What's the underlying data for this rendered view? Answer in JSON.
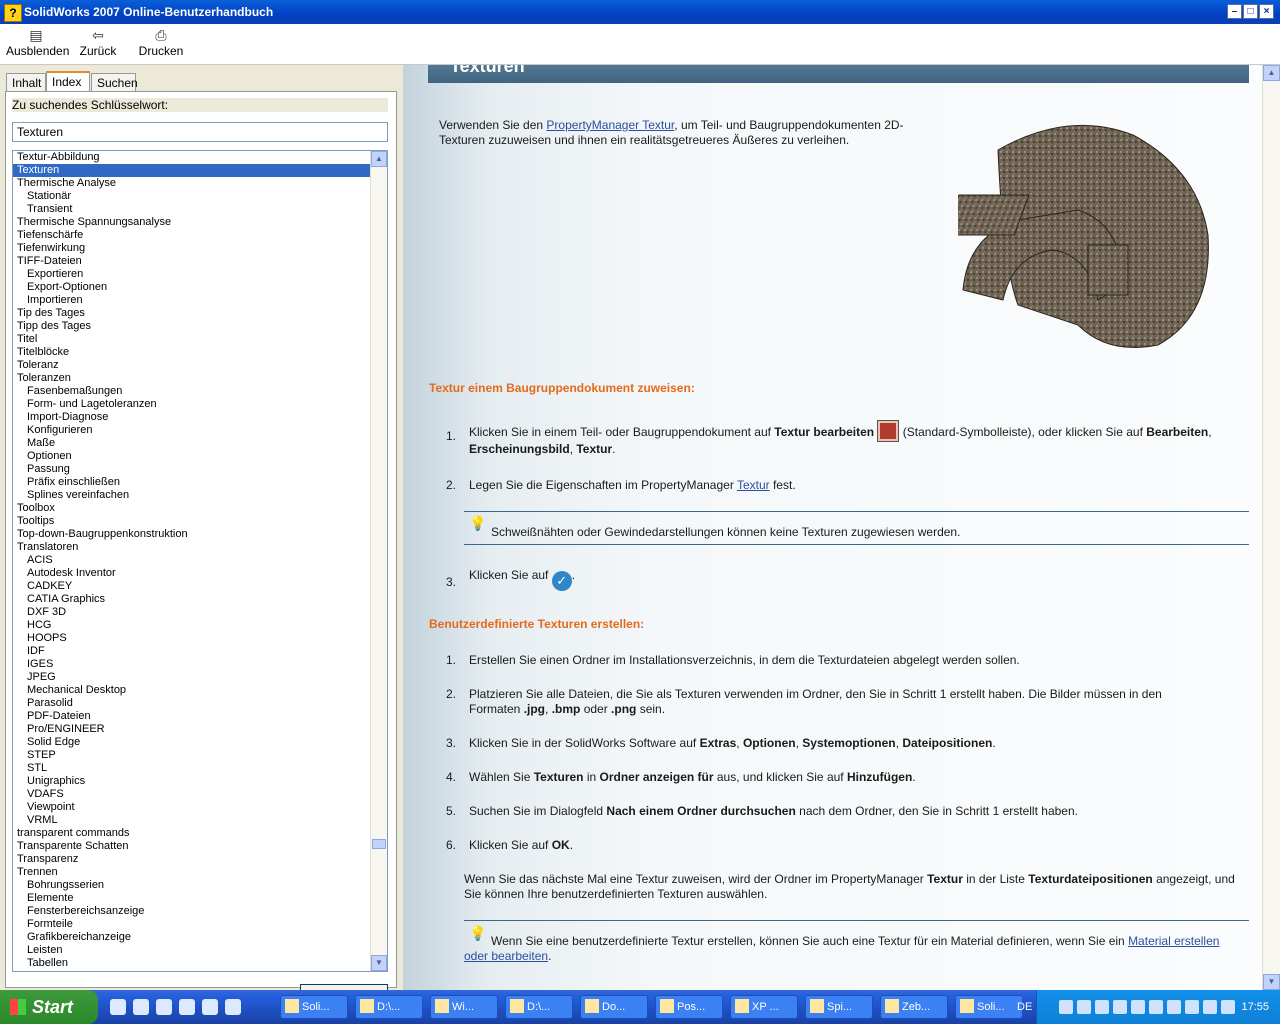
{
  "window": {
    "title": "SolidWorks 2007 Online-Benutzerhandbuch",
    "app_icon": "help-book-icon"
  },
  "toolbar": {
    "hide_label": "Ausblenden",
    "back_label": "Zurück",
    "print_label": "Drucken"
  },
  "tabs": [
    "Inhalt",
    "Index",
    "Suchen"
  ],
  "search": {
    "label": "Zu suchendes Schlüsselwort:",
    "value": "Texturen"
  },
  "index_items": [
    {
      "t": "Textur-Abbildung",
      "l": 0
    },
    {
      "t": "Texturen",
      "l": 0,
      "sel": true
    },
    {
      "t": "Thermische Analyse",
      "l": 0
    },
    {
      "t": "Stationär",
      "l": 1
    },
    {
      "t": "Transient",
      "l": 1
    },
    {
      "t": "Thermische Spannungsanalyse",
      "l": 0
    },
    {
      "t": "Tiefenschärfe",
      "l": 0
    },
    {
      "t": "Tiefenwirkung",
      "l": 0
    },
    {
      "t": "TIFF-Dateien",
      "l": 0
    },
    {
      "t": "Exportieren",
      "l": 1
    },
    {
      "t": "Export-Optionen",
      "l": 1
    },
    {
      "t": "Importieren",
      "l": 1
    },
    {
      "t": "Tip des Tages",
      "l": 0
    },
    {
      "t": "Tipp des Tages",
      "l": 0
    },
    {
      "t": "Titel",
      "l": 0
    },
    {
      "t": "Titelblöcke",
      "l": 0
    },
    {
      "t": "Toleranz",
      "l": 0
    },
    {
      "t": "Toleranzen",
      "l": 0
    },
    {
      "t": "Fasenbemaßungen",
      "l": 1
    },
    {
      "t": "Form- und Lagetoleranzen",
      "l": 1
    },
    {
      "t": "Import-Diagnose",
      "l": 1
    },
    {
      "t": "Konfigurieren",
      "l": 1
    },
    {
      "t": "Maße",
      "l": 1
    },
    {
      "t": "Optionen",
      "l": 1
    },
    {
      "t": "Passung",
      "l": 1
    },
    {
      "t": "Präfix einschließen",
      "l": 1
    },
    {
      "t": "Splines vereinfachen",
      "l": 1
    },
    {
      "t": "Toolbox",
      "l": 0
    },
    {
      "t": "Tooltips",
      "l": 0
    },
    {
      "t": "Top-down-Baugruppenkonstruktion",
      "l": 0
    },
    {
      "t": "Translatoren",
      "l": 0
    },
    {
      "t": "ACIS",
      "l": 1
    },
    {
      "t": "Autodesk Inventor",
      "l": 1
    },
    {
      "t": "CADKEY",
      "l": 1
    },
    {
      "t": "CATIA Graphics",
      "l": 1
    },
    {
      "t": "DXF 3D",
      "l": 1
    },
    {
      "t": "HCG",
      "l": 1
    },
    {
      "t": "HOOPS",
      "l": 1
    },
    {
      "t": "IDF",
      "l": 1
    },
    {
      "t": "IGES",
      "l": 1
    },
    {
      "t": "JPEG",
      "l": 1
    },
    {
      "t": "Mechanical Desktop",
      "l": 1
    },
    {
      "t": "Parasolid",
      "l": 1
    },
    {
      "t": "PDF-Dateien",
      "l": 1
    },
    {
      "t": "Pro/ENGINEER",
      "l": 1
    },
    {
      "t": "Solid Edge",
      "l": 1
    },
    {
      "t": "STEP",
      "l": 1
    },
    {
      "t": "STL",
      "l": 1
    },
    {
      "t": "Unigraphics",
      "l": 1
    },
    {
      "t": "VDAFS",
      "l": 1
    },
    {
      "t": "Viewpoint",
      "l": 1
    },
    {
      "t": "VRML",
      "l": 1
    },
    {
      "t": "transparent commands",
      "l": 0
    },
    {
      "t": "Transparente Schatten",
      "l": 0
    },
    {
      "t": "Transparenz",
      "l": 0
    },
    {
      "t": "Trennen",
      "l": 0
    },
    {
      "t": "Bohrungsserien",
      "l": 1
    },
    {
      "t": "Elemente",
      "l": 1
    },
    {
      "t": "Fensterbereichsanzeige",
      "l": 1
    },
    {
      "t": "Formteile",
      "l": 1
    },
    {
      "t": "Grafikbereichanzeige",
      "l": 1
    },
    {
      "t": "Leisten",
      "l": 1
    },
    {
      "t": "Tabellen",
      "l": 1
    }
  ],
  "content": {
    "heading": "Texturen",
    "intro_pre": "Verwenden Sie den ",
    "intro_link": "PropertyManager Textur",
    "intro_post1": ", um Teil- und Baugruppendokumenten 2D-",
    "intro_post2": "Texturen zuzuweisen und ihnen ein realitätsgetreueres Äußeres zu verleihen.",
    "section1_title": "Textur einem Baugruppendokument zuweisen:",
    "s1_1_a": "Klicken Sie in einem Teil- oder Baugruppendokument auf ",
    "s1_1_b": "Textur bearbeiten",
    "s1_1_c": " (Standard-Symbolleiste), oder klicken Sie auf ",
    "s1_1_d": "Bearbeiten",
    "s1_1_e": ",",
    "s1_1_f": "Erscheinungsbild",
    "s1_1_g": ", ",
    "s1_1_h": "Textur",
    "s1_1_i": ".",
    "s1_2_a": "Legen Sie die Eigenschaften im PropertyManager ",
    "s1_2_link": "Textur",
    "s1_2_b": " fest.",
    "note1": "Schweißnähten oder Gewindedarstellungen können keine Texturen zugewiesen werden.",
    "s1_3_a": "Klicken Sie auf ",
    "s1_3_b": ".",
    "section2_title": "Benutzerdefinierte Texturen erstellen:",
    "s2_1": "Erstellen Sie einen Ordner im Installationsverzeichnis, in dem die Texturdateien abgelegt werden sollen.",
    "s2_2_a": "Platzieren Sie alle Dateien, die Sie als Texturen verwenden im Ordner, den Sie in Schritt 1 erstellt haben. Die Bilder müssen in den",
    "s2_2_b": "Formaten ",
    "s2_2_jpg": ".jpg",
    "s2_2_c": ", ",
    "s2_2_bmp": ".bmp",
    "s2_2_d": " oder ",
    "s2_2_png": ".png",
    "s2_2_e": " sein.",
    "s2_3_a": "Klicken Sie in der SolidWorks Software auf ",
    "s2_3_b": "Extras",
    "s2_3_c": ", ",
    "s2_3_d": "Optionen",
    "s2_3_e": ", ",
    "s2_3_f": "Systemoptionen",
    "s2_3_g": ", ",
    "s2_3_h": "Dateipositionen",
    "s2_3_i": ".",
    "s2_4_a": "Wählen Sie ",
    "s2_4_b": "Texturen",
    "s2_4_c": " in ",
    "s2_4_d": "Ordner anzeigen für",
    "s2_4_e": " aus, und klicken Sie auf ",
    "s2_4_f": "Hinzufügen",
    "s2_4_g": ".",
    "s2_5_a": "Suchen Sie im Dialogfeld ",
    "s2_5_b": "Nach einem Ordner durchsuchen",
    "s2_5_c": " nach dem Ordner, den Sie in Schritt 1 erstellt haben.",
    "s2_6_a": "Klicken Sie auf ",
    "s2_6_b": "OK",
    "s2_6_c": ".",
    "after_a": "Wenn Sie das nächste Mal eine Textur zuweisen, wird der Ordner im PropertyManager ",
    "after_b": "Textur",
    "after_c": " in der Liste ",
    "after_d": "Texturdateipositionen",
    "after_e": " angezeigt, und",
    "after_f": "Sie können Ihre benutzerdefinierten Texturen auswählen.",
    "note2_a": "Wenn Sie eine benutzerdefinierte Textur erstellen, können Sie auch eine Textur für ein Material definieren, wenn Sie ein ",
    "note2_link1": "Material erstellen",
    "note2_link2": "oder bearbeiten",
    "note2_b": ".",
    "numbers": [
      "1.",
      "2.",
      "3.",
      "1.",
      "2.",
      "3.",
      "4.",
      "5.",
      "6."
    ]
  },
  "taskbar": {
    "start": "Start",
    "tasks": [
      "Soli...",
      "D:\\...",
      "Wi...",
      "D:\\...",
      "Do...",
      "Pos...",
      "XP ...",
      "Spi...",
      "Zeb...",
      "Soli..."
    ],
    "lang": "DE",
    "clock": "17:55"
  },
  "colors": {
    "accent_heading": "#e46b1b",
    "link": "#2a4ea0",
    "selection": "#316ac5"
  }
}
